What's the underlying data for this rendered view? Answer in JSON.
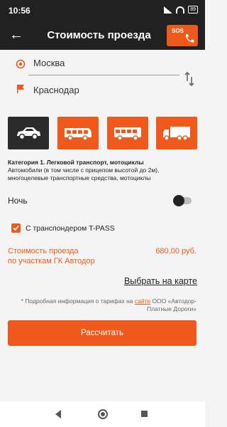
{
  "status": {
    "time": "10:56",
    "battery": "89"
  },
  "appbar": {
    "title": "Стоимость проезда",
    "sos_label": "SOS"
  },
  "route": {
    "from": "Москва",
    "to": "Краснодар"
  },
  "vehicles": [
    {
      "icon": "car-icon",
      "active": true
    },
    {
      "icon": "bus-icon",
      "active": false
    },
    {
      "icon": "coach-icon",
      "active": false
    },
    {
      "icon": "truck-icon",
      "active": false
    }
  ],
  "category": {
    "title": "Категория 1. Легковой транспорт, мотоциклы",
    "description": "Автомобили (в том числе с прицепом высотой до 2м), многоцелевые транспортные средства, мотоциклы"
  },
  "night": {
    "label": "Ночь",
    "enabled": false
  },
  "tpass": {
    "label": "С транспондером T-PASS",
    "checked": true
  },
  "cost": {
    "label_line1": "Стоимость проезда",
    "label_line2": "по участкам ГК Автодор",
    "price": "680,00 руб."
  },
  "map_link": "Выбрать на карте",
  "note": {
    "prefix": "* Подробная информация о тарифах на ",
    "link": "сайте",
    "suffix": " ООО «Автодор-Платные Дороги»"
  },
  "calculate_label": "Рассчитать",
  "colors": {
    "accent": "#ef5a1c",
    "dark": "#212121"
  }
}
